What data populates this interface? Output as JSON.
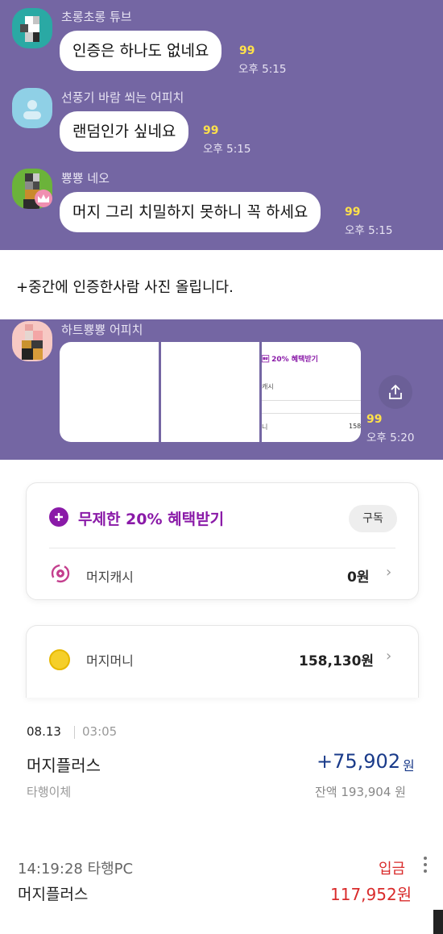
{
  "chat": {
    "messages": [
      {
        "sender": "초롱초롱 튜브",
        "text": "인증은 하나도 없네요",
        "count": "99",
        "time": "오후 5:15"
      },
      {
        "sender": "선풍기 바람 쐬는 어피치",
        "text": "랜덤인가 싶네요",
        "count": "99",
        "time": "오후 5:15"
      },
      {
        "sender": "뿅뿅 네오",
        "text": "머지 그리 치밀하지 못하니 꼭 하세요",
        "count": "99",
        "time": "오후 5:15"
      }
    ],
    "image_message": {
      "sender": "하트뿅뿅 어피치",
      "count": "99",
      "time": "오후 5:20",
      "thumb_title": "\b 20% 혜택받기",
      "thumb_row1": "캐시",
      "thumb_row2": "니",
      "thumb_value": "158"
    }
  },
  "note": "+중간에 인증한사람 사진 올립니다.",
  "promo": {
    "title": "무제한 20% 혜택받기",
    "subscribe_label": "구독",
    "cash_label": "머지캐시",
    "cash_value": "0원"
  },
  "money": {
    "label": "머지머니",
    "value": "158,130원"
  },
  "tx1": {
    "date": "08.13",
    "time": "03:05",
    "name": "머지플러스",
    "amount": "+75,902",
    "unit": "원",
    "type": "타행이체",
    "balance": "잔액 193,904 원"
  },
  "tx2": {
    "datetime": "14:19:28 타행PC",
    "kind": "입금",
    "name": "머지플러스",
    "amount": "117,952원"
  },
  "colors": {
    "chat_bg": "#7466a3",
    "count": "#ffe14a",
    "accent_purple": "#8a1aa8",
    "deposit_red": "#d92b2b",
    "amount_blue": "#1a3b8a"
  }
}
